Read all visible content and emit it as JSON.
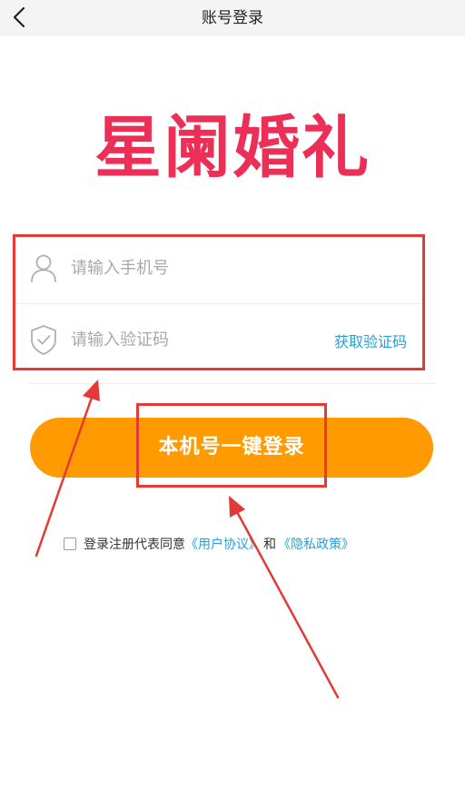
{
  "header": {
    "title": "账号登录",
    "back_icon": "chevron-left-icon"
  },
  "logo": {
    "text": "星阑婚礼",
    "color": "#ec2f57"
  },
  "form": {
    "phone_placeholder": "请输入手机号",
    "phone_icon": "user-icon",
    "code_placeholder": "请输入验证码",
    "code_icon": "shield-check-icon",
    "get_code_label": "获取验证码"
  },
  "login_button": {
    "label": "本机号一键登录",
    "color": "#ff9b00"
  },
  "agreement": {
    "prefix": "登录注册代表同意",
    "user_agreement": "《用户协议》",
    "and": "和",
    "privacy_policy": "《隐私政策》",
    "link_color": "#2a9fd8"
  },
  "annotations": {
    "highlight_color": "#e53935"
  }
}
